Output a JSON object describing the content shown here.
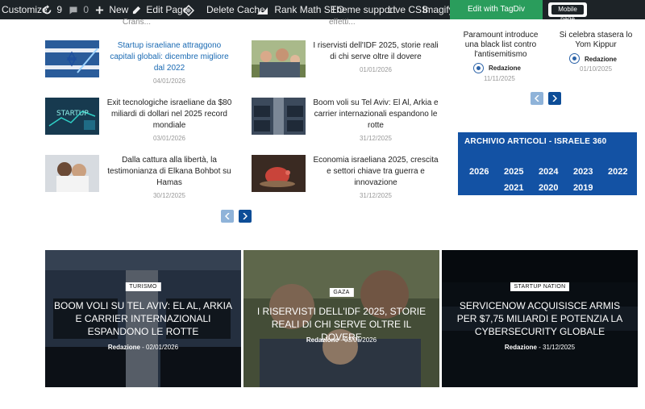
{
  "adminbar": {
    "customize": "Customize",
    "updates_count": "9",
    "comments_count": "0",
    "new": "New",
    "edit_page": "Edit Page",
    "delete_cache": "Delete Cache",
    "rank_math": "Rank Math SEO",
    "theme_support": "Theme support",
    "live_css": "Live CSS",
    "imagify": "Imagify",
    "tagdiv": "Edit with TagDiv Composer",
    "mobile_page": "Mobile page"
  },
  "truncated": {
    "left": "Crans...",
    "right": "effetti..."
  },
  "posts": [
    {
      "title": "Startup israeliane attraggono capitali globali: dicembre migliore dal 2022",
      "date": "04/01/2026"
    },
    {
      "title": "I riservisti dell'IDF 2025, storie reali di chi serve oltre il dovere",
      "date": "01/01/2026"
    },
    {
      "title": "Exit tecnologiche israeliane da $80 miliardi di dollari nel 2025 record mondiale",
      "date": "03/01/2026"
    },
    {
      "title": "Boom voli su Tel Aviv: El Al, Arkia e carrier internazionali espandono le rotte",
      "date": "31/12/2025"
    },
    {
      "title": "Dalla cattura alla libertà, la testimonianza di Elkana Bohbot su Hamas",
      "date": "30/12/2025"
    },
    {
      "title": "Economia israeliana 2025, crescita e settori chiave tra guerra e innovazione",
      "date": "31/12/2025"
    }
  ],
  "sidebar": {
    "posts": [
      {
        "title": "Paramount introduce una black list contro l'antisemitismo",
        "author": "Redazione",
        "date": "11/11/2025"
      },
      {
        "title": "Si celebra stasera lo Yom Kippur",
        "author": "Redazione",
        "date": "01/10/2025"
      }
    ],
    "archive": {
      "title": "ARCHIVIO ARTICOLI - ISRAELE 360",
      "years": [
        "2026",
        "2025",
        "2024",
        "2023",
        "2022",
        "2021",
        "2020",
        "2019"
      ]
    }
  },
  "cards": [
    {
      "tag": "TURISMO",
      "title": "Boom voli su Tel Aviv: El Al, Arkia e carrier internazionali espandono le rotte",
      "author": "Redazione",
      "date": "02/01/2026"
    },
    {
      "tag": "GAZA",
      "title": "I riservisti dell'IDF 2025, storie reali di chi serve oltre il dovere",
      "author": "Redazione",
      "date": "03/01/2026"
    },
    {
      "tag": "STARTUP NATION",
      "title": "ServiceNow acquisisce Armis per $7,75 miliardi e potenzia la cybersecurity globale",
      "author": "Redazione",
      "date": "31/12/2025"
    }
  ],
  "colors": {
    "brand": "#1352a4",
    "link": "#1a6ab3",
    "adminbar": "#1d2327",
    "tagdiv": "#2a9d5c"
  }
}
